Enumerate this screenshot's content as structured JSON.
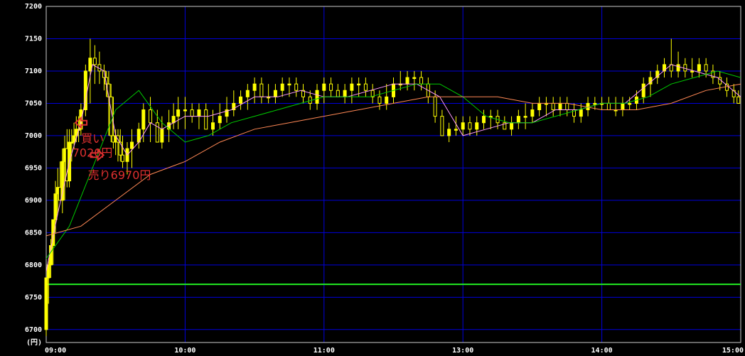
{
  "chart_data": {
    "type": "candlestick",
    "ylabel": "(円)",
    "ylim": [
      6680,
      7200
    ],
    "y_ticks": [
      "7200",
      "7150",
      "7100",
      "7050",
      "7000",
      "6950",
      "6900",
      "6850",
      "6800",
      "6750",
      "6700"
    ],
    "x_ticks": [
      "09:00",
      "10:00",
      "11:00",
      "13:00",
      "14:00",
      "15:00"
    ],
    "x_tick_minutes": [
      0,
      60,
      120,
      180,
      240,
      300
    ],
    "xlim_minutes": [
      0,
      300
    ],
    "grid": true,
    "colors": {
      "background": "#000000",
      "grid": "#0000dd",
      "axis_text": "#ffffff",
      "candle": "#ffff00",
      "ma_short": "#ff99ff",
      "ma_mid": "#00cc00",
      "ma_long": "#ff8855",
      "reference_line": "#22ee22",
      "annotation": "#e03030"
    },
    "reference_line": {
      "value": 6770
    },
    "series": [
      {
        "kind": "candles",
        "x": [
          0,
          1,
          2,
          3,
          4,
          5,
          6,
          7,
          8,
          9,
          10,
          11,
          12,
          13,
          14,
          15,
          17,
          19,
          21,
          23,
          25,
          26,
          27,
          28,
          29,
          30,
          31,
          32,
          33,
          35,
          37,
          40,
          42,
          45,
          48,
          50,
          53,
          55,
          57,
          60,
          63,
          66,
          69,
          72,
          75,
          78,
          81,
          84,
          87,
          90,
          93,
          96,
          99,
          102,
          105,
          108,
          111,
          114,
          117,
          120,
          123,
          126,
          129,
          132,
          135,
          138,
          141,
          144,
          147,
          150,
          153,
          156,
          159,
          162,
          165,
          168,
          171,
          174,
          177,
          180,
          183,
          186,
          189,
          192,
          195,
          198,
          201,
          204,
          207,
          210,
          213,
          216,
          219,
          222,
          225,
          228,
          231,
          234,
          237,
          240,
          243,
          246,
          249,
          252,
          255,
          258,
          261,
          264,
          267,
          270,
          273,
          276,
          279,
          282,
          285,
          288,
          291,
          294,
          297,
          299
        ],
        "open": [
          6700,
          6780,
          6800,
          6830,
          6870,
          6910,
          6920,
          6900,
          6960,
          6980,
          6930,
          6990,
          6990,
          7000,
          7010,
          7010,
          7040,
          7100,
          7120,
          7110,
          7100,
          7090,
          7080,
          7060,
          7000,
          6990,
          7000,
          6990,
          6970,
          6960,
          6980,
          6990,
          7010,
          7040,
          7020,
          6990,
          7010,
          7020,
          7030,
          7040,
          7040,
          7030,
          7040,
          7010,
          7020,
          7030,
          7040,
          7050,
          7060,
          7070,
          7080,
          7060,
          7060,
          7070,
          7080,
          7080,
          7070,
          7060,
          7050,
          7070,
          7080,
          7070,
          7060,
          7070,
          7080,
          7080,
          7070,
          7060,
          7050,
          7060,
          7080,
          7080,
          7090,
          7090,
          7080,
          7060,
          7030,
          7000,
          7010,
          7010,
          7020,
          7010,
          7020,
          7030,
          7030,
          7020,
          7010,
          7020,
          7030,
          7030,
          7040,
          7050,
          7050,
          7040,
          7050,
          7040,
          7030,
          7040,
          7050,
          7050,
          7050,
          7040,
          7040,
          7050,
          7050,
          7060,
          7080,
          7090,
          7100,
          7110,
          7100,
          7110,
          7100,
          7100,
          7110,
          7100,
          7090,
          7080,
          7070,
          7060
        ],
        "high": [
          6730,
          6810,
          6840,
          6870,
          6930,
          6950,
          6960,
          6980,
          7000,
          7010,
          7010,
          7010,
          7020,
          7030,
          7030,
          7050,
          7110,
          7150,
          7140,
          7130,
          7110,
          7100,
          7100,
          7080,
          7060,
          7010,
          7010,
          7010,
          7000,
          6990,
          7010,
          7020,
          7050,
          7060,
          7040,
          7030,
          7040,
          7050,
          7060,
          7060,
          7050,
          7050,
          7050,
          7040,
          7050,
          7060,
          7070,
          7070,
          7080,
          7090,
          7090,
          7080,
          7080,
          7090,
          7090,
          7090,
          7080,
          7070,
          7080,
          7090,
          7090,
          7080,
          7080,
          7090,
          7090,
          7090,
          7080,
          7070,
          7080,
          7090,
          7100,
          7100,
          7100,
          7100,
          7090,
          7070,
          7040,
          7020,
          7030,
          7030,
          7030,
          7030,
          7040,
          7040,
          7040,
          7030,
          7030,
          7040,
          7050,
          7050,
          7060,
          7060,
          7060,
          7060,
          7060,
          7050,
          7050,
          7060,
          7060,
          7060,
          7060,
          7060,
          7060,
          7060,
          7070,
          7090,
          7100,
          7110,
          7120,
          7150,
          7130,
          7120,
          7120,
          7120,
          7120,
          7110,
          7100,
          7090,
          7080,
          7070
        ],
        "low": [
          6690,
          6740,
          6780,
          6800,
          6850,
          6880,
          6900,
          6880,
          6900,
          6920,
          6920,
          6960,
          6980,
          6990,
          6990,
          7000,
          7030,
          7050,
          7080,
          7080,
          7070,
          7060,
          7000,
          6990,
          6980,
          6970,
          6960,
          6960,
          6950,
          6940,
          6950,
          6980,
          6990,
          6990,
          6990,
          6980,
          6990,
          7010,
          7010,
          7010,
          7020,
          7010,
          7010,
          7000,
          7010,
          7020,
          7030,
          7040,
          7040,
          7050,
          7050,
          7050,
          7050,
          7060,
          7060,
          7060,
          7050,
          7040,
          7040,
          7050,
          7060,
          7060,
          7050,
          7050,
          7060,
          7060,
          7050,
          7040,
          7040,
          7050,
          7070,
          7070,
          7070,
          7070,
          7050,
          7020,
          7000,
          6990,
          7000,
          7000,
          7000,
          7000,
          7010,
          7010,
          7010,
          7010,
          7000,
          7010,
          7010,
          7020,
          7030,
          7030,
          7030,
          7030,
          7030,
          7020,
          7020,
          7030,
          7040,
          7040,
          7040,
          7030,
          7030,
          7040,
          7040,
          7050,
          7060,
          7080,
          7090,
          7090,
          7090,
          7090,
          7090,
          7090,
          7090,
          7080,
          7070,
          7060,
          7050,
          7050
        ],
        "close": [
          6780,
          6800,
          6830,
          6870,
          6910,
          6920,
          6900,
          6960,
          6980,
          6930,
          6990,
          6990,
          7000,
          7010,
          7010,
          7040,
          7100,
          7120,
          7110,
          7100,
          7090,
          7080,
          7060,
          7000,
          6990,
          7000,
          6990,
          6970,
          6960,
          6980,
          6990,
          7010,
          7040,
          7020,
          6990,
          7010,
          7020,
          7030,
          7040,
          7040,
          7030,
          7040,
          7010,
          7020,
          7030,
          7040,
          7050,
          7060,
          7070,
          7080,
          7060,
          7060,
          7070,
          7080,
          7080,
          7070,
          7060,
          7050,
          7070,
          7080,
          7070,
          7060,
          7070,
          7080,
          7080,
          7070,
          7060,
          7050,
          7060,
          7080,
          7080,
          7090,
          7090,
          7080,
          7060,
          7030,
          7000,
          7010,
          7010,
          7020,
          7010,
          7020,
          7030,
          7030,
          7020,
          7010,
          7020,
          7030,
          7030,
          7040,
          7050,
          7050,
          7040,
          7050,
          7040,
          7030,
          7040,
          7050,
          7050,
          7050,
          7040,
          7040,
          7050,
          7050,
          7060,
          7080,
          7090,
          7100,
          7110,
          7100,
          7110,
          7100,
          7100,
          7110,
          7100,
          7090,
          7080,
          7070,
          7060,
          7050
        ]
      },
      {
        "kind": "line",
        "key": "ma_short",
        "x": [
          0,
          5,
          10,
          15,
          20,
          25,
          30,
          35,
          40,
          45,
          50,
          55,
          60,
          70,
          80,
          90,
          100,
          110,
          120,
          130,
          140,
          150,
          160,
          170,
          180,
          190,
          200,
          210,
          220,
          230,
          240,
          250,
          260,
          270,
          280,
          290,
          300
        ],
        "values": [
          6790,
          6880,
          6960,
          7020,
          7110,
          7100,
          7000,
          6970,
          6990,
          7020,
          7010,
          7020,
          7030,
          7030,
          7040,
          7060,
          7060,
          7070,
          7060,
          7060,
          7070,
          7080,
          7080,
          7060,
          7000,
          7010,
          7020,
          7020,
          7040,
          7040,
          7050,
          7050,
          7080,
          7110,
          7100,
          7090,
          7060
        ]
      },
      {
        "kind": "line",
        "key": "ma_mid",
        "x": [
          0,
          10,
          20,
          30,
          40,
          50,
          60,
          70,
          80,
          90,
          100,
          110,
          120,
          130,
          140,
          150,
          160,
          170,
          180,
          190,
          200,
          210,
          220,
          230,
          240,
          250,
          260,
          270,
          280,
          290,
          300
        ],
        "values": [
          6810,
          6860,
          6950,
          7040,
          7070,
          7020,
          6990,
          7000,
          7020,
          7030,
          7040,
          7050,
          7060,
          7060,
          7060,
          7070,
          7080,
          7080,
          7060,
          7030,
          7020,
          7020,
          7030,
          7040,
          7050,
          7050,
          7060,
          7080,
          7090,
          7100,
          7090
        ]
      },
      {
        "kind": "line",
        "key": "ma_long",
        "x": [
          0,
          15,
          30,
          45,
          60,
          75,
          90,
          105,
          120,
          135,
          150,
          165,
          180,
          195,
          210,
          225,
          240,
          255,
          270,
          285,
          300
        ],
        "values": [
          6845,
          6860,
          6900,
          6940,
          6960,
          6990,
          7010,
          7020,
          7030,
          7040,
          7050,
          7060,
          7060,
          7060,
          7050,
          7050,
          7040,
          7040,
          7050,
          7070,
          7080
        ]
      }
    ],
    "annotations": [
      {
        "label_lines": [
          "買い",
          "7020円"
        ],
        "x": 12,
        "y": 7020
      },
      {
        "label_lines": [
          "売り6970円"
        ],
        "x": 26,
        "y": 6970
      }
    ]
  }
}
